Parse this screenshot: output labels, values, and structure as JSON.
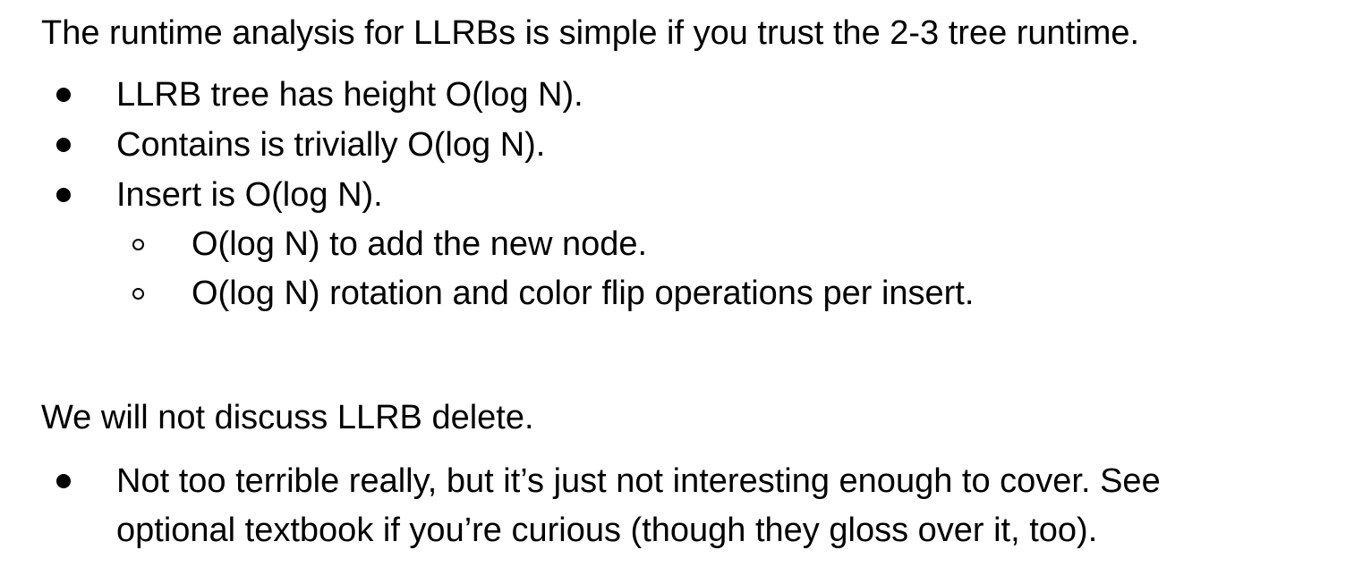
{
  "section1": {
    "intro": "The runtime analysis for LLRBs is simple if you trust the 2-3 tree runtime.",
    "bullets": [
      "LLRB tree has height O(log N).",
      "Contains is trivially O(log N).",
      "Insert is O(log N)."
    ],
    "sub_bullets": [
      "O(log N) to add the new node.",
      "O(log N) rotation and color flip operations per insert."
    ]
  },
  "section2": {
    "intro": "We will not discuss LLRB delete.",
    "bullet_line1": "Not too terrible really, but it’s just not interesting enough to cover. See",
    "bullet_line2": "optional textbook if you’re curious (though they gloss over it, too)."
  }
}
